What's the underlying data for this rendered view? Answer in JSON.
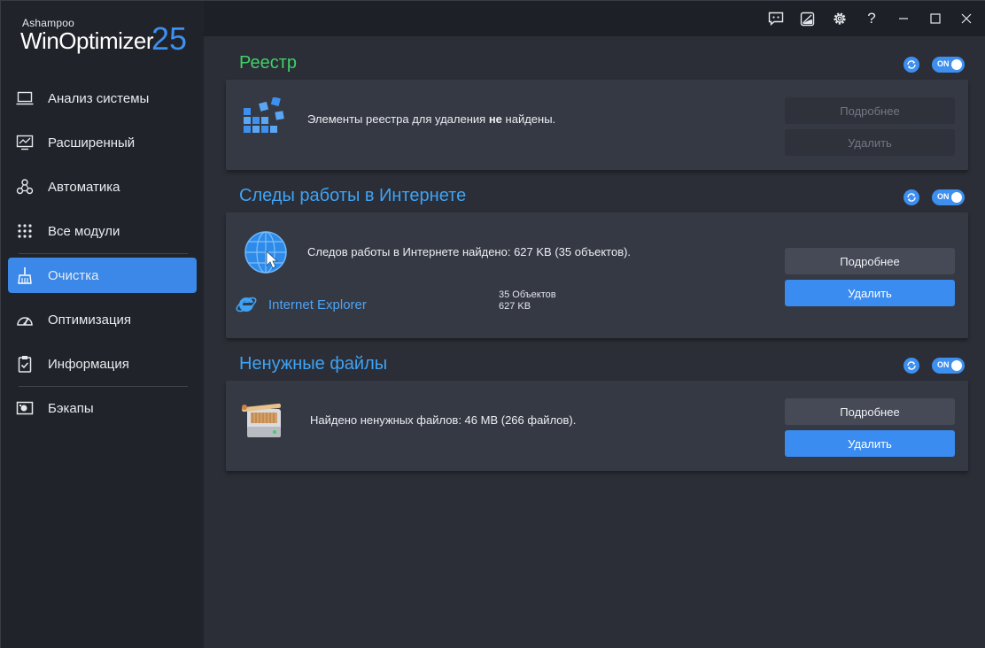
{
  "app": {
    "vendor": "Ashampoo",
    "name": "WinOptimizer",
    "version": "25"
  },
  "sidebar": {
    "items": [
      {
        "label": "Анализ системы",
        "icon": "laptop-icon"
      },
      {
        "label": "Расширенный",
        "icon": "chart-monitor-icon"
      },
      {
        "label": "Автоматика",
        "icon": "automation-icon"
      },
      {
        "label": "Все модули",
        "icon": "grid-dots-icon"
      },
      {
        "label": "Очистка",
        "icon": "broom-icon",
        "active": true
      },
      {
        "label": "Оптимизация",
        "icon": "speedometer-icon"
      },
      {
        "label": "Информация",
        "icon": "clipboard-check-icon"
      },
      {
        "label": "Бэкапы",
        "icon": "backup-drive-icon"
      }
    ]
  },
  "titlebar": {
    "buttons": [
      "feedback-icon",
      "skin-icon",
      "settings-icon",
      "help-icon",
      "minimize-icon",
      "maximize-icon",
      "close-icon"
    ],
    "help_glyph": "?"
  },
  "sections": {
    "registry": {
      "title": "Реестр",
      "title_color": "#3fd06a",
      "toggle": "ON",
      "text_before": "Элементы реестра для удаления ",
      "text_bold": "не",
      "text_after": " найдены.",
      "details_label": "Подробнее",
      "delete_label": "Удалить",
      "buttons_enabled": false
    },
    "internet": {
      "title": "Следы работы в Интернете",
      "title_color": "#3fa3f5",
      "toggle": "ON",
      "text": "Следов работы в Интернете найдено: 627 KB (35 объектов).",
      "details_label": "Подробнее",
      "delete_label": "Удалить",
      "browser": {
        "name": "Internet Explorer",
        "objects": "35 Объектов",
        "size": "627 KB"
      }
    },
    "junk": {
      "title": "Ненужные файлы",
      "title_color": "#3fa3f5",
      "toggle": "ON",
      "text": "Найдено ненужных файлов: 46 MB (266 файлов).",
      "details_label": "Подробнее",
      "delete_label": "Удалить"
    }
  },
  "colors": {
    "accent": "#3d8ff0",
    "sidebar_bg": "#20232a",
    "main_bg": "#2b2e36",
    "card_bg": "#353944"
  }
}
